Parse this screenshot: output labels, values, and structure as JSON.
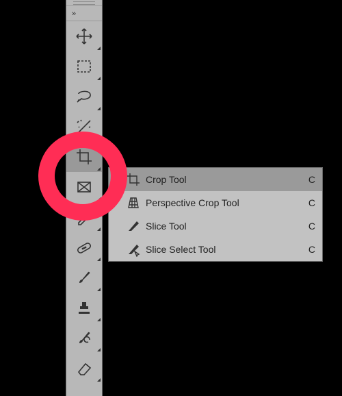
{
  "toolbar": {
    "expand_glyph": "»",
    "tools": [
      {
        "id": "move",
        "label": "Move Tool"
      },
      {
        "id": "marquee",
        "label": "Rectangular Marquee Tool"
      },
      {
        "id": "lasso",
        "label": "Lasso Tool"
      },
      {
        "id": "magic-wand",
        "label": "Quick Selection Tool"
      },
      {
        "id": "crop",
        "label": "Crop Tool",
        "selected": true
      },
      {
        "id": "frame",
        "label": "Frame Tool"
      },
      {
        "id": "eyedropper",
        "label": "Eyedropper Tool"
      },
      {
        "id": "healing",
        "label": "Spot Healing Brush Tool"
      },
      {
        "id": "brush",
        "label": "Brush Tool"
      },
      {
        "id": "stamp",
        "label": "Clone Stamp Tool"
      },
      {
        "id": "history-brush",
        "label": "History Brush Tool"
      },
      {
        "id": "eraser",
        "label": "Eraser Tool"
      }
    ]
  },
  "flyout": {
    "items": [
      {
        "label": "Crop Tool",
        "shortcut": "C",
        "selected": true,
        "icon": "crop"
      },
      {
        "label": "Perspective Crop Tool",
        "shortcut": "C",
        "icon": "perspective-crop"
      },
      {
        "label": "Slice Tool",
        "shortcut": "C",
        "icon": "slice"
      },
      {
        "label": "Slice Select Tool",
        "shortcut": "C",
        "icon": "slice-select"
      }
    ]
  },
  "annotation": {
    "ring_color": "#ff2d55"
  }
}
